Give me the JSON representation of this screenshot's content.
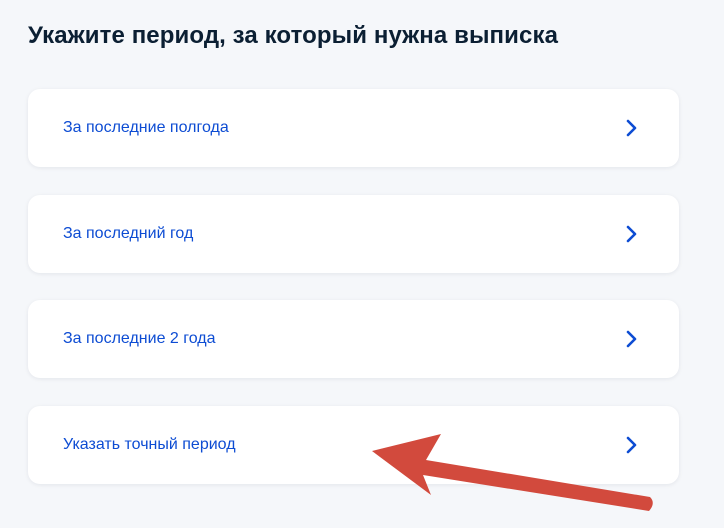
{
  "page": {
    "title": "Укажите период, за который нужна выписка"
  },
  "options": [
    {
      "label": "За последние полгода"
    },
    {
      "label": "За последний год"
    },
    {
      "label": "За последние 2 года"
    },
    {
      "label": "Указать точный период"
    }
  ],
  "colors": {
    "background": "#f5f7fa",
    "title": "#0b1f33",
    "link": "#0d4cd3",
    "annotation_arrow": "#d24a3d"
  },
  "icons": {
    "option_chevron": "chevron-right-icon",
    "annotation": "red-arrow-icon"
  }
}
